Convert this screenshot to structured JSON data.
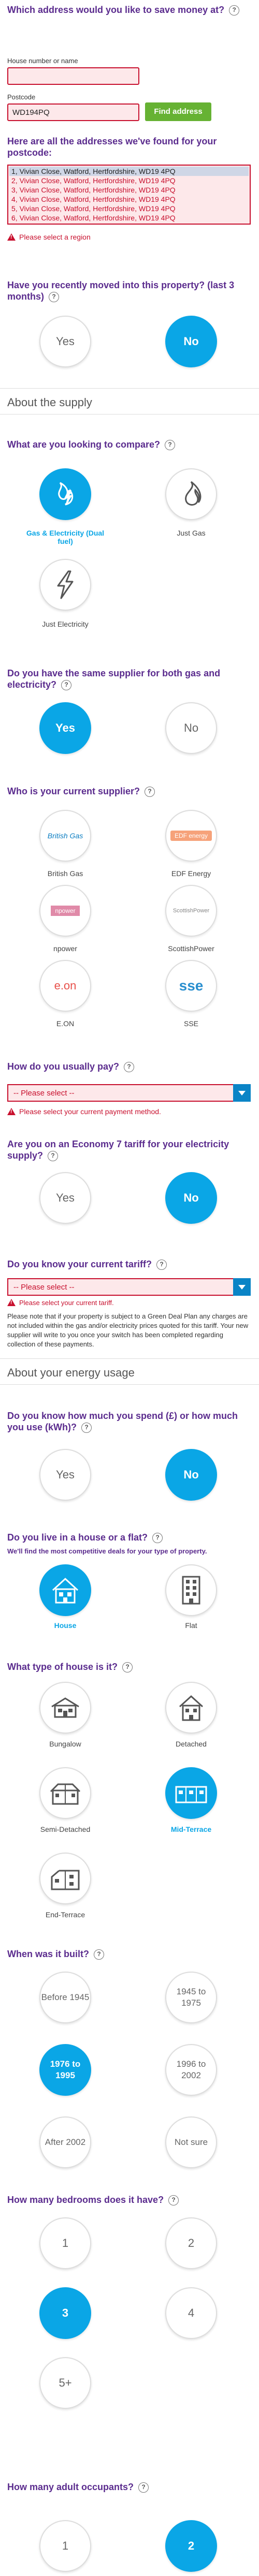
{
  "address": {
    "title": "Which address would you like to save money at?",
    "house_label": "House number or name",
    "house_value": "",
    "postcode_label": "Postcode",
    "postcode_value": "WD194PQ",
    "find_button": "Find address",
    "list_title": "Here are all the addresses we've found for your postcode:",
    "options": [
      "1, Vivian Close, Watford, Hertfordshire, WD19 4PQ",
      "2, Vivian Close, Watford, Hertfordshire, WD19 4PQ",
      "3, Vivian Close, Watford, Hertfordshire, WD19 4PQ",
      "4, Vivian Close, Watford, Hertfordshire, WD19 4PQ",
      "5, Vivian Close, Watford, Hertfordshire, WD19 4PQ",
      "6, Vivian Close, Watford, Hertfordshire, WD19 4PQ"
    ],
    "error": "Please select a region"
  },
  "moved": {
    "title": "Have you recently moved into this property? (last 3 months)",
    "yes": "Yes",
    "no": "No",
    "selected": "no"
  },
  "supply_section": "About the supply",
  "compare": {
    "title": "What are you looking to compare?",
    "options": [
      "Gas & Electricity (Dual fuel)",
      "Just Gas",
      "Just Electricity"
    ]
  },
  "same_supplier": {
    "title": "Do you have the same supplier for both gas and electricity?",
    "yes": "Yes",
    "no": "No"
  },
  "current_supplier": {
    "title": "Who is your current supplier?",
    "suppliers": [
      "British Gas",
      "EDF Energy",
      "npower",
      "ScottishPower",
      "E.ON",
      "SSE"
    ],
    "logo_text": [
      "British Gas",
      "EDF energy",
      "npower",
      "ScottishPower",
      "e.on",
      "sse"
    ]
  },
  "pay": {
    "title": "How do you usually pay?",
    "select_placeholder": "-- Please select --",
    "error": "Please select your current payment method."
  },
  "economy7": {
    "title": "Are you on an Economy 7 tariff for your electricity supply?",
    "yes": "Yes",
    "no": "No"
  },
  "tariff": {
    "title": "Do you know your current tariff?",
    "select_placeholder": "-- Please select --",
    "error": "Please select your current tariff.",
    "note": "Please note that if your property is subject to a Green Deal Plan any charges are not included within the gas and/or electricity prices quoted for this tariff. Your new supplier will write to you once your switch has been completed regarding collection of these payments."
  },
  "usage_section": "About your energy usage",
  "spend": {
    "title": "Do you know how much you spend (£) or how much you use (kWh)?",
    "yes": "Yes",
    "no": "No"
  },
  "house_or_flat": {
    "title": "Do you live in a house or a flat?",
    "subtitle": "We'll find the most competitive deals for your type of property.",
    "options": [
      "House",
      "Flat"
    ]
  },
  "house_type": {
    "title": "What type of house is it?",
    "options": [
      "Bungalow",
      "Detached",
      "Semi-Detached",
      "Mid-Terrace",
      "End-Terrace"
    ]
  },
  "built": {
    "title": "When was it built?",
    "options": [
      "Before 1945",
      "1945 to 1975",
      "1976 to 1995",
      "1996 to 2002",
      "After 2002",
      "Not sure"
    ]
  },
  "bedrooms": {
    "title": "How many bedrooms does it have?",
    "options": [
      "1",
      "2",
      "3",
      "4",
      "5+"
    ]
  },
  "occupants": {
    "title": "How many adult occupants?",
    "options": [
      "1",
      "2"
    ]
  },
  "help_glyph": "?",
  "colors": {
    "accent_blue": "#0aa6e6",
    "question_purple": "#5b2c8e",
    "error_red": "#c8102e",
    "button_green": "#66b233"
  }
}
